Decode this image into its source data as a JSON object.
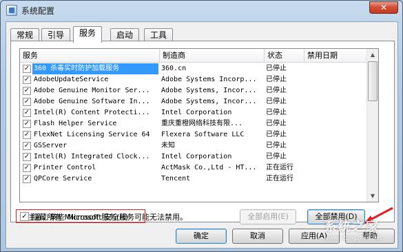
{
  "window": {
    "title": "系统配置",
    "close_glyph": "✕"
  },
  "tabs": [
    {
      "label": "常规"
    },
    {
      "label": "引导"
    },
    {
      "label": "服务"
    },
    {
      "label": "启动"
    },
    {
      "label": "工具"
    }
  ],
  "active_tab": "服务",
  "columns": {
    "service": "服务",
    "manufacturer": "制造商",
    "status": "状态",
    "disabled_date": "禁用日期"
  },
  "services": [
    {
      "checked": true,
      "name": "360 杀毒实时防护加载服务",
      "manufacturer": "360.cn",
      "status": "已停止",
      "selected": true
    },
    {
      "checked": true,
      "name": "AdobeUpdateService",
      "manufacturer": "Adobe Systems Incorp...",
      "status": "已停止"
    },
    {
      "checked": true,
      "name": "Adobe Genuine Monitor Ser...",
      "manufacturer": "Adobe Systems, Incor...",
      "status": "已停止"
    },
    {
      "checked": true,
      "name": "Adobe Genuine Software In...",
      "manufacturer": "Adobe Systems, Incor...",
      "status": "已停止"
    },
    {
      "checked": true,
      "name": "Intel(R) Content Protecti...",
      "manufacturer": "Intel Corporation",
      "status": "已停止"
    },
    {
      "checked": true,
      "name": "Flash Helper Service",
      "manufacturer": "重庆重橙网络科技有限...",
      "status": "已停止"
    },
    {
      "checked": true,
      "name": "FlexNet Licensing Service 64",
      "manufacturer": "Flexera Software LLC",
      "status": "已停止"
    },
    {
      "checked": true,
      "name": "GSServer",
      "manufacturer": "未知",
      "status": "已停止"
    },
    {
      "checked": true,
      "name": "Intel(R) Integrated Clock...",
      "manufacturer": "Intel Corporation",
      "status": "已停止"
    },
    {
      "checked": true,
      "name": "Printer Control",
      "manufacturer": "ActMask Co.,Ltd - HT...",
      "status": "正在运行"
    },
    {
      "checked": true,
      "name": "QPCore Service",
      "manufacturer": "Tencent",
      "status": "正在运行"
    }
  ],
  "check_glyph": "✓",
  "note": "请注意，某些 Microsoft 安全服务可能无法禁用。",
  "enable_all_button": "全部启用(E)",
  "disable_all_button": "全部禁用(D)",
  "hide_microsoft": {
    "label": "隐藏所有 Microsoft 服务(H)",
    "checked": true
  },
  "footer_buttons": {
    "ok": "确定",
    "cancel": "取消",
    "apply": "应用(A)",
    "help": "帮助"
  },
  "watermark": {
    "text": "系统之家",
    "sub": "www.xitongzhijia.net"
  },
  "colors": {
    "selection": "#3399ff",
    "highlight_box": "#e02020",
    "arrow": "#e02020"
  }
}
